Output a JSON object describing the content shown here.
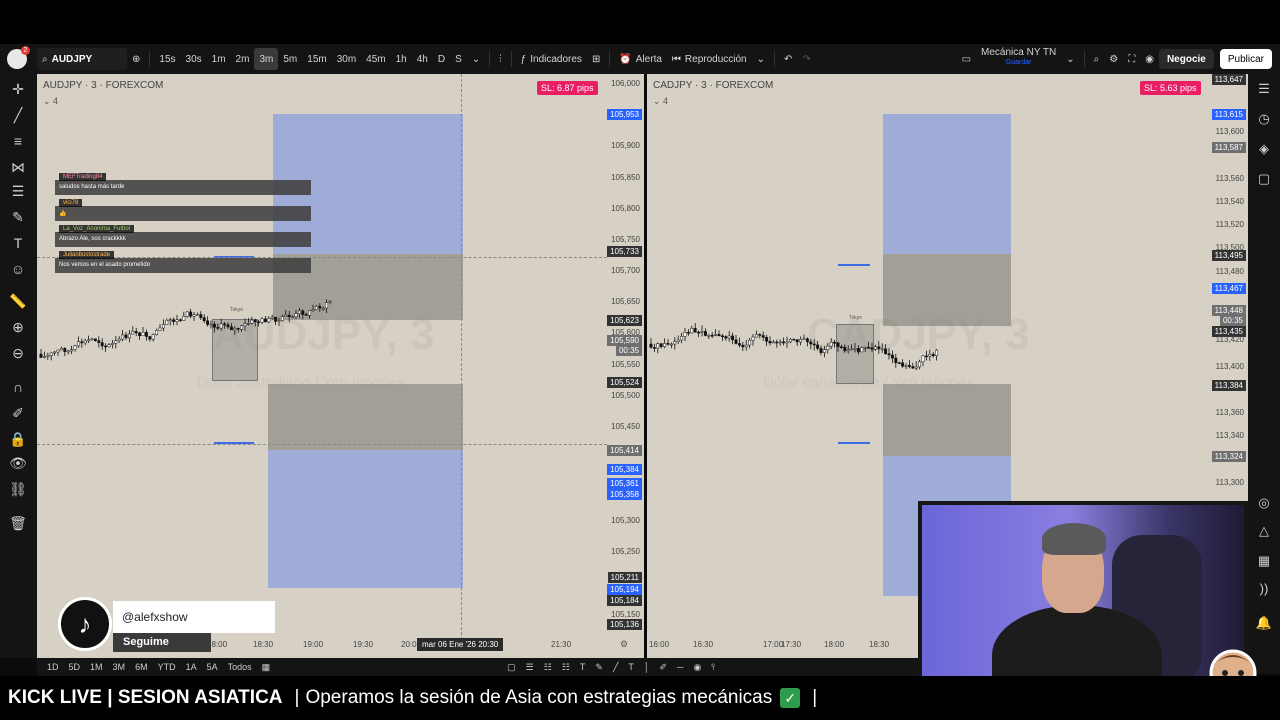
{
  "toolbar": {
    "notifications": "2",
    "symbol": "AUDJPY",
    "intervals": [
      "15s",
      "30s",
      "1m",
      "2m",
      "3m",
      "5m",
      "15m",
      "30m",
      "45m",
      "1h",
      "4h",
      "D",
      "S"
    ],
    "active_interval": "3m",
    "indicators": "Indicadores",
    "alert": "Alerta",
    "replay": "Reproducción",
    "layout_name": "Mecánica NY TN",
    "layout_save": "Guardar",
    "trade": "Negocie",
    "publish": "Publicar"
  },
  "left_chart": {
    "title": "AUDJPY · 3 · FOREXCOM",
    "indicator_count": "4",
    "sl_badge": "SL: 6.87 pips",
    "watermark": "AUDJPY, 3",
    "watermark_sub": "Dólar australiano / Yen japonés",
    "zone_label": "Tokyo",
    "y_ticks": [
      "106,000",
      "105,900",
      "105,850",
      "105,800",
      "105,750",
      "105,700",
      "105,650",
      "105,600",
      "105,550",
      "105,500",
      "105,450",
      "105,300",
      "105,250",
      "105,150"
    ],
    "price_labels": {
      "top_blue": "105,953",
      "dark_1": "105,733",
      "dark_2": "105,623",
      "grey_1": "105,590",
      "grey_1_sub": "00:35",
      "dark_3": "105,524",
      "grey_2": "105,414",
      "blue_1": "105,384",
      "blue_2": "105,361",
      "blue_3": "105,358",
      "dark_4": "105,211",
      "blue_4": "105,194",
      "dark_5": "105,184",
      "dark_6": "105,136"
    },
    "x_ticks": [
      "18:00",
      "18:30",
      "19:00",
      "19:30",
      "20:00",
      "21:30"
    ],
    "crosshair_time": "mar 06 Ene '26   20:30"
  },
  "right_chart": {
    "title": "CADJPY · 3 · FOREXCOM",
    "indicator_count": "4",
    "sl_badge": "SL: 5.63 pips",
    "watermark": "CADJPY, 3",
    "watermark_sub": "Dólar canadiense / Yen japonés",
    "zone_label": "Tokyo",
    "y_ticks": [
      "113,600",
      "113,560",
      "113,540",
      "113,520",
      "113,500",
      "113,480",
      "113,420",
      "113,400",
      "113,360",
      "113,340",
      "113,300"
    ],
    "price_labels": {
      "dark_top": "113,647",
      "blue_1": "113,615",
      "grey_1": "113,587",
      "dark_1": "113,495",
      "blue_2": "113,467",
      "grey_2": "113,448",
      "grey_2_sub": "00:35",
      "dark_2": "113,435",
      "dark_3": "113,384",
      "grey_3": "113,324"
    },
    "x_ticks": [
      "16:00",
      "16:30",
      "17:00",
      "17:30",
      "18:00",
      "18:30"
    ]
  },
  "chat": [
    {
      "user": "MEFTrading84",
      "user_color": "#ff8aa8",
      "message": "saludos hasta más tarde"
    },
    {
      "user": "vici78",
      "user_color": "#ffb74d",
      "message": "👍"
    },
    {
      "user": "La_Voz_Anonima_Futbol",
      "user_color": "#9ccc65",
      "message": "Abrazo Ale, sos crackkkk"
    },
    {
      "user": "Julianbustostrade",
      "user_color": "#ffb74d",
      "message": "Nos vemos en el asado prometido"
    }
  ],
  "timeframes": [
    "1D",
    "5D",
    "1M",
    "3M",
    "6M",
    "YTD",
    "1A",
    "5A",
    "Todos"
  ],
  "tiktok": {
    "handle": "@alefxshow",
    "follow": "Seguime"
  },
  "ticker": {
    "left": "KICK LIVE | SESION ASIATICA",
    "separator": "|",
    "message": "Operamos la sesión de Asia con estrategias mecánicas",
    "check": "✓",
    "tail": "|"
  },
  "colors": {
    "chart_bg": "#d6d0c5",
    "zone_blue": "#8ca0dc",
    "zone_grey": "#787670",
    "accent_blue": "#2962ff",
    "sl_badge": "#e91e63"
  }
}
